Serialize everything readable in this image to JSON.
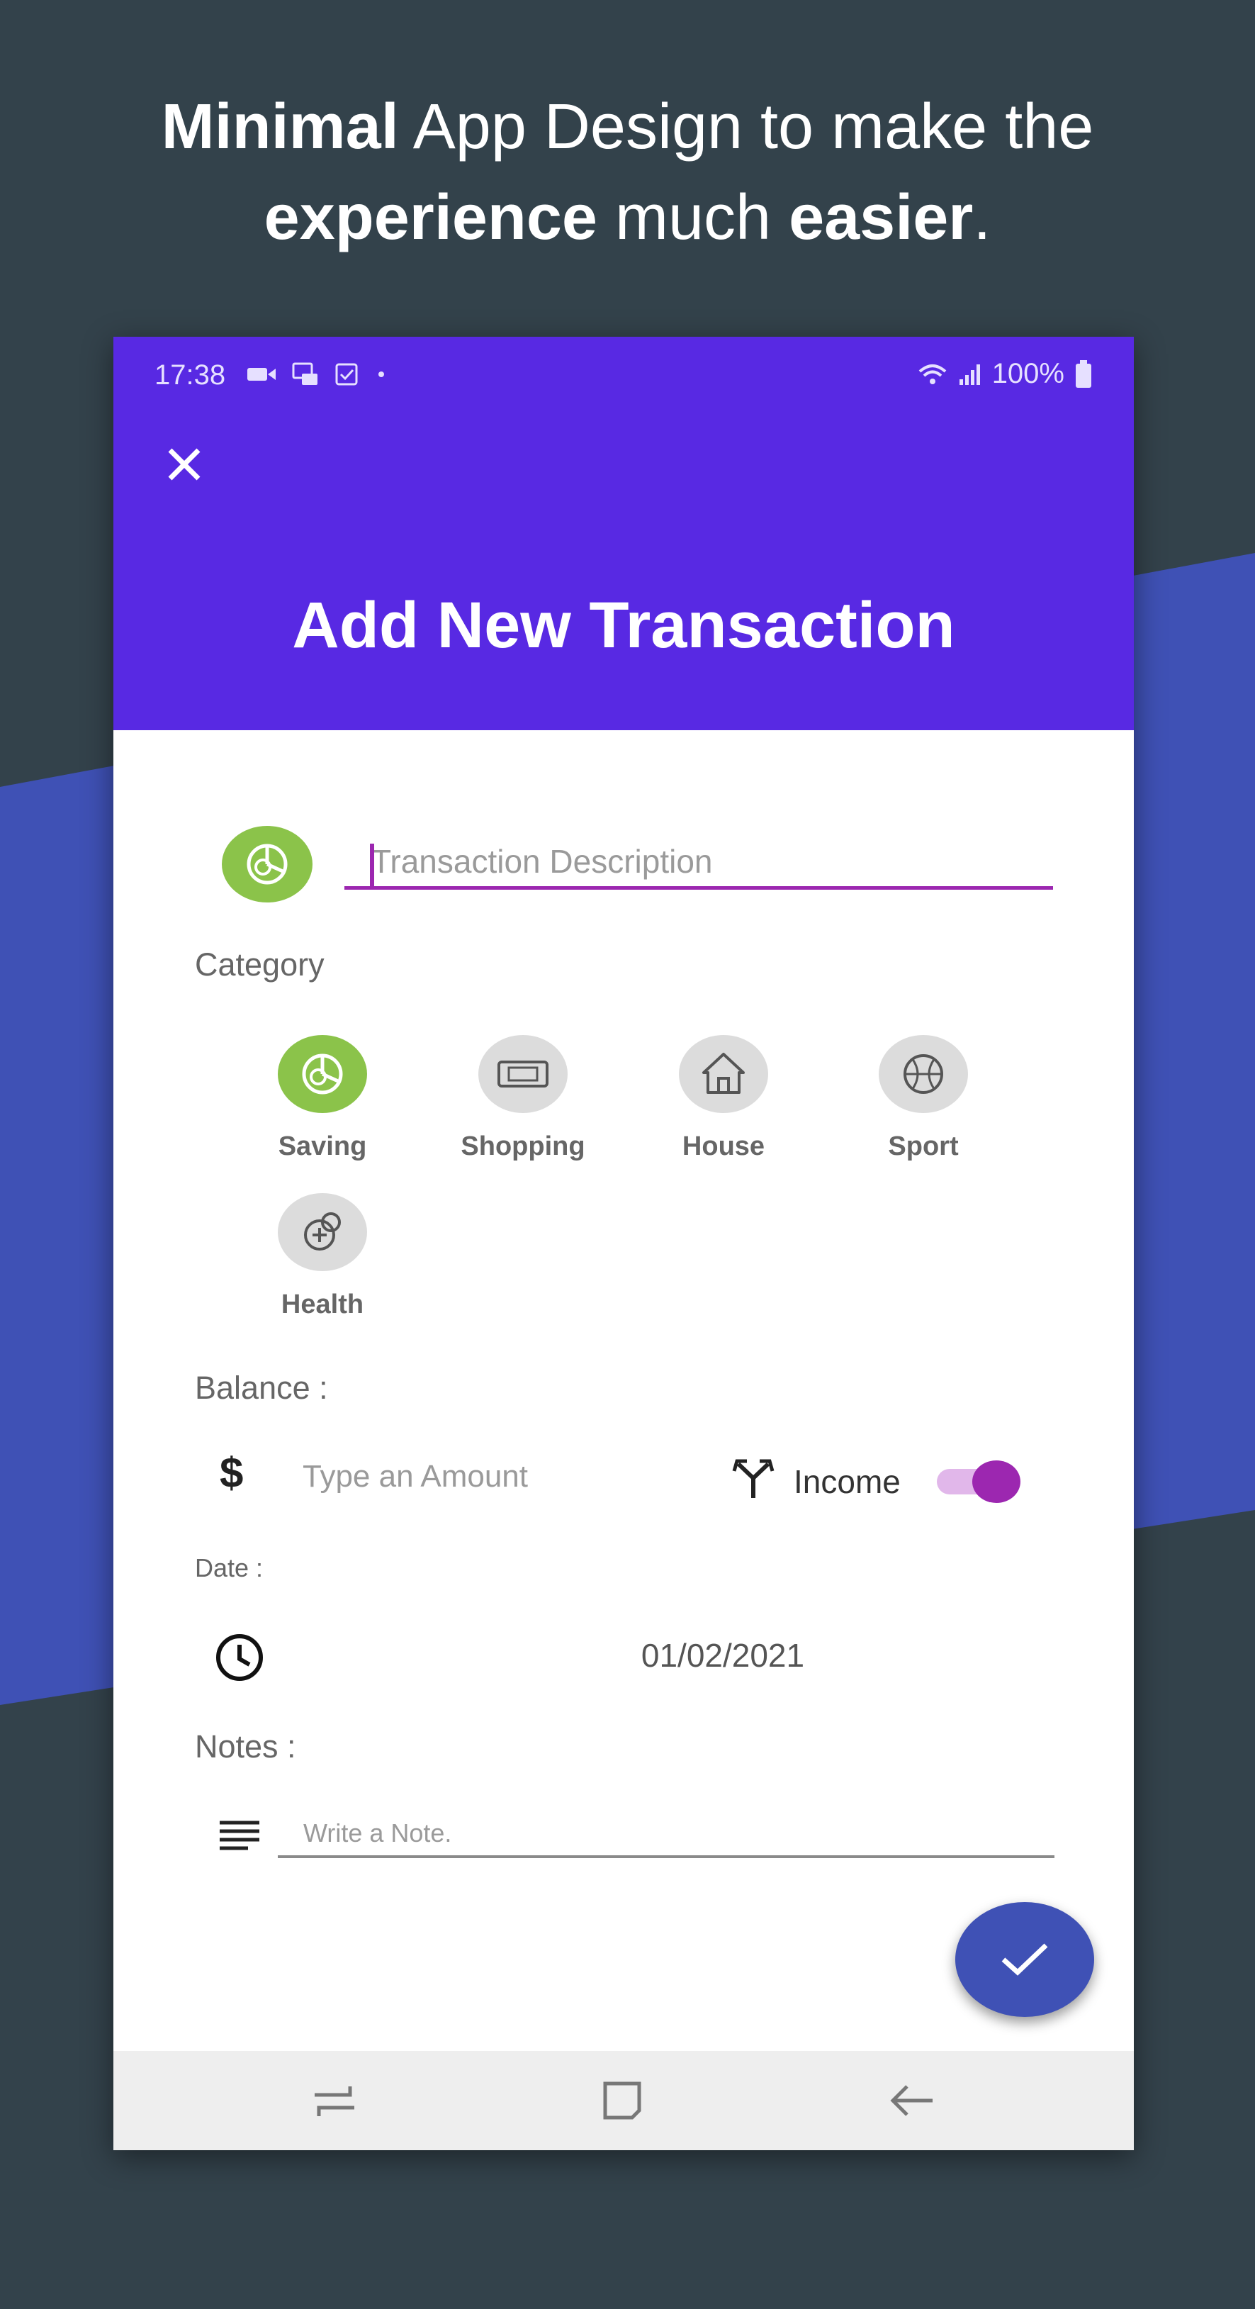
{
  "headline": {
    "bold1": "Minimal",
    "text1": " App Design to make the",
    "bold2": "experience",
    "text2": " much ",
    "bold3": "easier",
    "text3": "."
  },
  "status_bar": {
    "time": "17:38",
    "battery": "100%"
  },
  "header": {
    "title": "Add New Transaction",
    "close_icon": "close-icon"
  },
  "description": {
    "placeholder": "Transaction Description",
    "value": ""
  },
  "category": {
    "label": "Category",
    "items": [
      {
        "label": "Saving",
        "icon": "piggy-chart-icon",
        "selected": true
      },
      {
        "label": "Shopping",
        "icon": "ticket-icon",
        "selected": false
      },
      {
        "label": "House",
        "icon": "house-icon",
        "selected": false
      },
      {
        "label": "Sport",
        "icon": "basketball-icon",
        "selected": false
      },
      {
        "label": "Health",
        "icon": "health-icon",
        "selected": false
      }
    ]
  },
  "balance": {
    "label": "Balance :",
    "currency_symbol": "$",
    "amount_placeholder": "Type an Amount",
    "type_label": "Income",
    "income_enabled": true
  },
  "date": {
    "label": "Date :",
    "value": "01/02/2021"
  },
  "notes": {
    "label": "Notes :",
    "placeholder": "Write a Note."
  },
  "colors": {
    "appbar": "#5829e3",
    "selected_category": "#8bc34a",
    "accent": "#9c27b0",
    "fab": "#3f51b5",
    "background": "#33424b",
    "band": "#3f51b5"
  }
}
